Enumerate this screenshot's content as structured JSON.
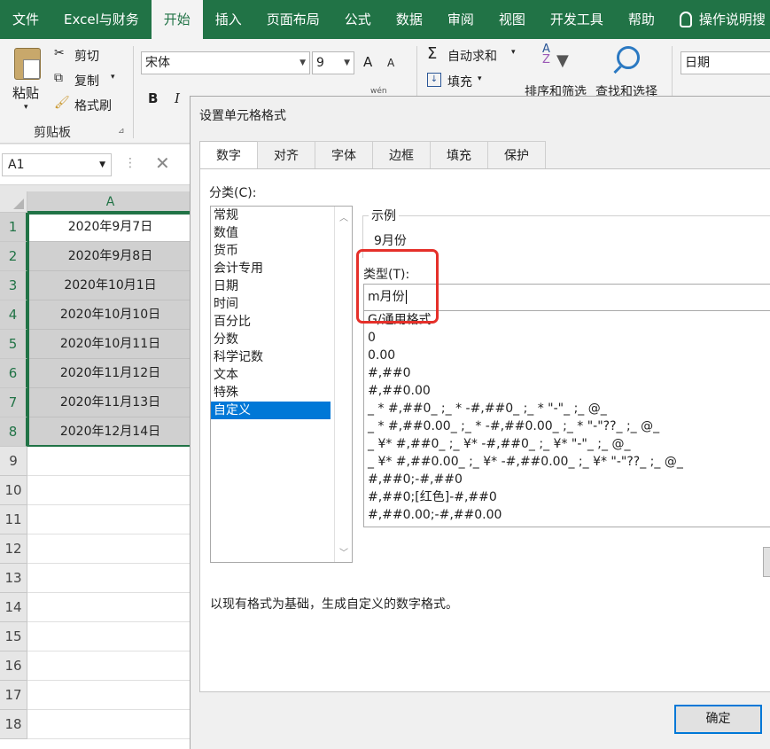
{
  "ribbon_tabs": [
    "文件",
    "Excel与财务",
    "开始",
    "插入",
    "页面布局",
    "公式",
    "数据",
    "审阅",
    "视图",
    "开发工具",
    "帮助"
  ],
  "active_tab_index": 2,
  "tell_me": "操作说明搜",
  "clipboard": {
    "paste": "粘贴",
    "cut": "剪切",
    "copy": "复制",
    "format_painter": "格式刷",
    "group_label": "剪贴板"
  },
  "font": {
    "name": "宋体",
    "size": "9",
    "grow": "A",
    "shrink": "A",
    "bold": "B",
    "italic": "I",
    "phonetic": "wén"
  },
  "editing": {
    "autosum": "自动求和",
    "fill": "填充",
    "sort_filter": "排序和筛选",
    "find_select": "查找和选择"
  },
  "number_format_box": "日期",
  "name_box": "A1",
  "sheet": {
    "column_header": "A",
    "rows": [
      "1",
      "2",
      "3",
      "4",
      "5",
      "6",
      "7",
      "8",
      "9",
      "10",
      "11",
      "12",
      "13",
      "14",
      "15",
      "16",
      "17",
      "18"
    ],
    "cells": [
      "2020年9月7日",
      "2020年9月8日",
      "2020年10月1日",
      "2020年10月10日",
      "2020年10月11日",
      "2020年11月12日",
      "2020年11月13日",
      "2020年12月14日"
    ]
  },
  "dialog": {
    "title": "设置单元格格式",
    "tabs": [
      "数字",
      "对齐",
      "字体",
      "边框",
      "填充",
      "保护"
    ],
    "category_label": "分类(C):",
    "categories": [
      "常规",
      "数值",
      "货币",
      "会计专用",
      "日期",
      "时间",
      "百分比",
      "分数",
      "科学记数",
      "文本",
      "特殊",
      "自定义"
    ],
    "selected_category_index": 11,
    "sample_title": "示例",
    "sample_value": "9月份",
    "type_label": "类型(T):",
    "type_value": "m月份",
    "formats": [
      "G/通用格式",
      "0",
      "0.00",
      "#,##0",
      "#,##0.00",
      "_ * #,##0_ ;_ * -#,##0_ ;_ * \"-\"_ ;_ @_",
      "_ * #,##0.00_ ;_ * -#,##0.00_ ;_ * \"-\"??_ ;_ @_",
      "_ ¥* #,##0_ ;_ ¥* -#,##0_ ;_ ¥* \"-\"_ ;_ @_",
      "_ ¥* #,##0.00_ ;_ ¥* -#,##0.00_ ;_ ¥* \"-\"??_ ;_ @_",
      "#,##0;-#,##0",
      "#,##0;[红色]-#,##0",
      "#,##0.00;-#,##0.00"
    ],
    "note": "以现有格式为基础，生成自定义的数字格式。",
    "ok": "确定"
  },
  "colors": {
    "excel_green": "#217346",
    "highlight": "#e5302a",
    "selection_blue": "#0078d7"
  }
}
